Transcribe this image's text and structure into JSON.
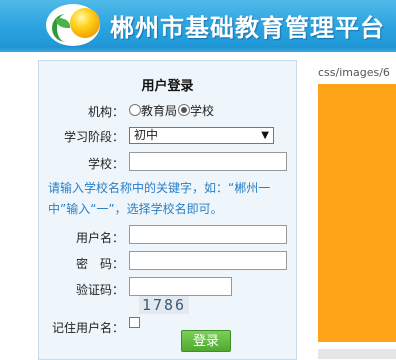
{
  "header": {
    "site_title": "郴州市基础教育管理平台",
    "logo_icon": "sun-leaf-logo-icon"
  },
  "login": {
    "title": "用户登录",
    "org_label": "机构：",
    "org_options": [
      "教育局",
      "学校"
    ],
    "org_selected": "学校",
    "stage_label": "学习阶段：",
    "stage_value": "初中",
    "school_label": "学校：",
    "school_value": "",
    "hint": "请输入学校名称中的关键字，如：“郴州一中”输入“一”，选择学校名即可。",
    "username_label": "用户名：",
    "username_value": "",
    "password_label": "密　码：",
    "password_value": "",
    "captcha_label": "验证码：",
    "captcha_value": "",
    "captcha_image_text": "1786",
    "remember_label": "记住用户名：",
    "remember_checked": false,
    "submit_label": "登录"
  },
  "side": {
    "image_path_text": "css/images/6"
  },
  "colors": {
    "header_blue": "#2aa2df",
    "panel_bg": "#eef6fb",
    "hint_blue": "#2a7fc7",
    "button_green": "#5fb93f",
    "orange": "#ffa317"
  }
}
